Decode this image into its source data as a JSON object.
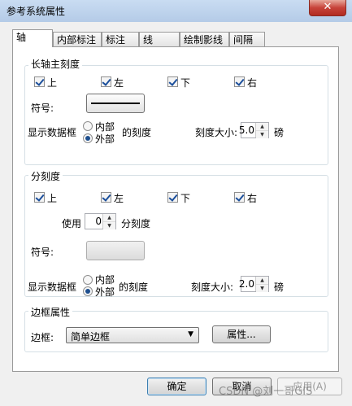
{
  "window": {
    "title": "参考系统属性",
    "close_glyph": "✕"
  },
  "tabs": [
    {
      "label": "轴",
      "active": true
    },
    {
      "label": "内部标注"
    },
    {
      "label": "标注"
    },
    {
      "label": "线"
    },
    {
      "label": "绘制影线"
    },
    {
      "label": "间隔"
    }
  ],
  "major_ticks": {
    "title": "长轴主刻度",
    "checks": [
      "上",
      "左",
      "下",
      "右"
    ],
    "symbol_label": "符号:",
    "display_label": "显示数据框",
    "radio_inside": "内部",
    "radio_outside": "外部",
    "selected": "外部",
    "ticks_suffix": "的刻度",
    "size_label": "刻度大小:",
    "size_value": "5.0",
    "unit": "磅"
  },
  "minor_ticks": {
    "title": "分刻度",
    "checks": [
      "上",
      "左",
      "下",
      "右"
    ],
    "use_label": "使用",
    "use_value": "0",
    "use_suffix": "分刻度",
    "symbol_label": "符号:",
    "display_label": "显示数据框",
    "radio_inside": "内部",
    "radio_outside": "外部",
    "selected": "外部",
    "ticks_suffix": "的刻度",
    "size_label": "刻度大小:",
    "size_value": "2.0",
    "unit": "磅"
  },
  "border": {
    "title": "边框属性",
    "label": "边框:",
    "value": "简单边框",
    "properties_button": "属性..."
  },
  "footer": {
    "ok": "确定",
    "cancel": "取消",
    "apply": "应用(A)"
  },
  "watermark": "CSDN @刘一哥GIS"
}
